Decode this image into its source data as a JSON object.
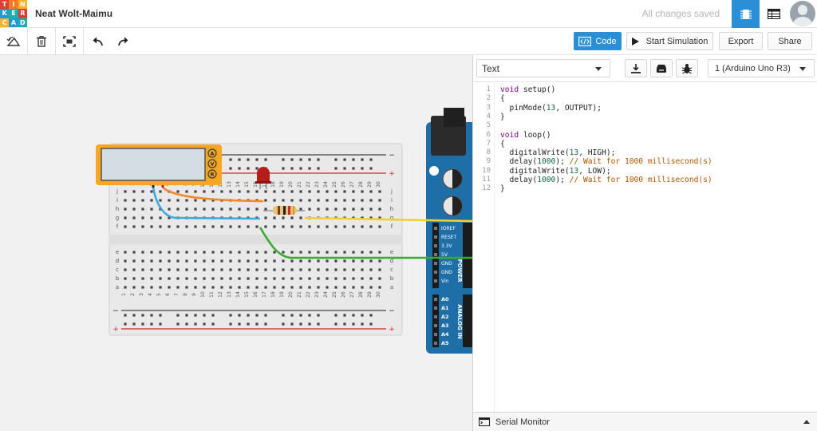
{
  "logo": {
    "letters": [
      "T",
      "I",
      "N",
      "K",
      "E",
      "R",
      "C",
      "A",
      "D"
    ],
    "colors": [
      "#e23d2e",
      "#f47b21",
      "#f7b42c",
      "#1c9bd6",
      "#17b1b0",
      "#e23d2e",
      "#f7b42c",
      "#1c9bd6",
      "#17b1b0"
    ]
  },
  "header": {
    "project_title": "Neat Wolt-Maimu",
    "save_status": "All changes saved"
  },
  "toolbar": {
    "code_label": "Code",
    "simulate_label": "Start Simulation",
    "export_label": "Export",
    "share_label": "Share"
  },
  "code_panel": {
    "mode": "Text",
    "device": "1 (Arduino Uno R3)",
    "line_numbers": [
      "1",
      "2",
      "3",
      "4",
      "5",
      "6",
      "7",
      "8",
      "9",
      "10",
      "11",
      "12"
    ],
    "code_lines": [
      "void setup()",
      "{",
      "  pinMode(13, OUTPUT);",
      "}",
      "",
      "void loop()",
      "{",
      "  digitalWrite(13, HIGH);",
      "  delay(1000); // Wait for 1000 millisecond(s)",
      "  digitalWrite(13, LOW);",
      "  delay(1000); // Wait for 1000 millisecond(s)",
      "}"
    ],
    "serial_monitor_label": "Serial Monitor"
  },
  "multimeter": {
    "modes": [
      "A",
      "V",
      "R"
    ]
  },
  "breadboard": {
    "column_numbers": [
      "1",
      "2",
      "3",
      "4",
      "5",
      "6",
      "7",
      "8",
      "9",
      "10",
      "11",
      "12",
      "13",
      "14",
      "15",
      "16",
      "17",
      "18",
      "19",
      "20",
      "21",
      "22",
      "23",
      "24",
      "25",
      "26",
      "27",
      "28",
      "29",
      "30"
    ],
    "row_letters_top": [
      "j",
      "i",
      "h",
      "g",
      "f"
    ],
    "row_letters_bottom": [
      "e",
      "d",
      "c",
      "b",
      "a"
    ],
    "rail_minus": "−",
    "rail_plus": "+"
  },
  "arduino": {
    "power_pins": [
      "IOREF",
      "RESET",
      "3.3V",
      "5V",
      "GND",
      "GND",
      "Vin"
    ],
    "power_label": "POWER",
    "analog_pins": [
      "A0",
      "A1",
      "A2",
      "A3",
      "A4",
      "A5"
    ],
    "analog_label": "ANALOG IN"
  },
  "colors": {
    "accent": "#2a8fd5",
    "arduino": "#1e6ea7",
    "wire_orange": "#f08a24",
    "wire_blue": "#3fa9e0",
    "wire_green": "#3aaa35",
    "wire_yellow": "#f2d02e",
    "led": "#b71c1c",
    "multimeter": "#f5a623"
  }
}
